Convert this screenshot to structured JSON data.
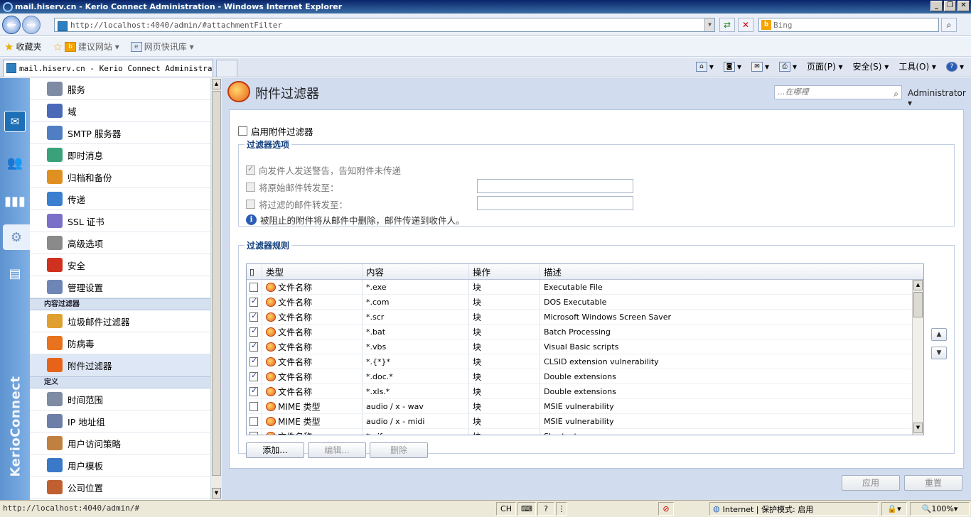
{
  "window": {
    "title": "mail.hiserv.cn - Kerio Connect Administration - Windows Internet Explorer",
    "url": "http://localhost:4040/admin/#attachmentFilter",
    "search_placeholder": "Bing",
    "tab_title": "mail.hiserv.cn - Kerio Connect Administra...",
    "buttons": {
      "minimize": "_",
      "restore": "❐",
      "close": "✕"
    }
  },
  "favorites": {
    "favorites_label": "收藏夹",
    "suggested_sites": "建议网站 ▾",
    "web_slice": "网页快讯库 ▾"
  },
  "commands": {
    "page": "页面(P) ▾",
    "safety": "安全(S) ▾",
    "tools": "工具(O) ▾"
  },
  "sidebar": {
    "brand": "KerioConnect",
    "items_top": [
      {
        "label": "服务",
        "icon": "services-icon",
        "color": "#7f8aa3"
      },
      {
        "label": "域",
        "icon": "domain-icon",
        "color": "#4a6ab8"
      },
      {
        "label": "SMTP 服务器",
        "icon": "smtp-server-icon",
        "color": "#4f7fc2"
      },
      {
        "label": "即时消息",
        "icon": "instant-message-icon",
        "color": "#3aa27a"
      },
      {
        "label": "归档和备份",
        "icon": "archive-backup-icon",
        "color": "#e09020"
      },
      {
        "label": "传递",
        "icon": "delivery-icon",
        "color": "#3a7fd0"
      },
      {
        "label": "SSL 证书",
        "icon": "ssl-certificate-icon",
        "color": "#7a70c8"
      },
      {
        "label": "高级选项",
        "icon": "advanced-options-icon",
        "color": "#8a8a8a"
      },
      {
        "label": "安全",
        "icon": "security-icon",
        "color": "#d0301e"
      },
      {
        "label": "管理设置",
        "icon": "admin-settings-icon",
        "color": "#6e86b6"
      }
    ],
    "section_content_filter": "内容过滤器",
    "items_filter": [
      {
        "label": "垃圾邮件过滤器",
        "icon": "spam-filter-icon",
        "color": "#e0a030"
      },
      {
        "label": "防病毒",
        "icon": "antivirus-icon",
        "color": "#e8721e"
      },
      {
        "label": "附件过滤器",
        "icon": "attachment-filter-icon",
        "color": "#e8631a"
      }
    ],
    "section_definitions": "定义",
    "items_defs": [
      {
        "label": "时间范围",
        "icon": "time-range-icon",
        "color": "#7f8aa3"
      },
      {
        "label": "IP 地址组",
        "icon": "ip-group-icon",
        "color": "#6d7fa6"
      },
      {
        "label": "用户访问策略",
        "icon": "user-access-policy-icon",
        "color": "#c08040"
      },
      {
        "label": "用户模板",
        "icon": "user-template-icon",
        "color": "#3a78c8"
      },
      {
        "label": "公司位置",
        "icon": "company-location-icon",
        "color": "#c06030"
      }
    ]
  },
  "main": {
    "title": "附件过滤器",
    "search_placeholder": "...在哪裡",
    "user": "Administrator ▾",
    "enable_label": "启用附件过滤器",
    "options_legend": "过滤器选项",
    "opt_warn": "向发件人发送警告，告知附件未传递",
    "opt_forward_original": "将原始邮件转发至：",
    "opt_forward_filtered": "将过滤的邮件转发至：",
    "info_text": "被阻止的附件将从邮件中删除，邮件传递到收件人。",
    "rules_legend": "过滤器规则",
    "columns": {
      "type": "类型",
      "content": "内容",
      "action": "操作",
      "description": "描述"
    },
    "rules": [
      {
        "checked": false,
        "type": "文件名称",
        "content": "*.exe",
        "action": "块",
        "description": "Executable File"
      },
      {
        "checked": true,
        "type": "文件名称",
        "content": "*.com",
        "action": "块",
        "description": "DOS Executable"
      },
      {
        "checked": true,
        "type": "文件名称",
        "content": "*.scr",
        "action": "块",
        "description": "Microsoft Windows Screen Saver"
      },
      {
        "checked": true,
        "type": "文件名称",
        "content": "*.bat",
        "action": "块",
        "description": "Batch Processing"
      },
      {
        "checked": true,
        "type": "文件名称",
        "content": "*.vbs",
        "action": "块",
        "description": "Visual Basic scripts"
      },
      {
        "checked": true,
        "type": "文件名称",
        "content": "*.{*}*",
        "action": "块",
        "description": "CLSID extension vulnerability"
      },
      {
        "checked": true,
        "type": "文件名称",
        "content": "*.doc.*",
        "action": "块",
        "description": "Double extensions"
      },
      {
        "checked": true,
        "type": "文件名称",
        "content": "*.xls.*",
        "action": "块",
        "description": "Double extensions"
      },
      {
        "checked": false,
        "type": "MIME 类型",
        "content": "audio / x - wav",
        "action": "块",
        "description": "MSIE vulnerability"
      },
      {
        "checked": false,
        "type": "MIME 类型",
        "content": "audio / x - midi",
        "action": "块",
        "description": "MSIE vulnerability"
      },
      {
        "checked": false,
        "type": "文件名称",
        "content": "*.pif",
        "action": "块",
        "description": "Shortcut"
      }
    ],
    "add": "添加...",
    "edit": "编辑...",
    "delete": "删除",
    "apply": "应用",
    "reset": "重置"
  },
  "status": {
    "url": "http://localhost:4040/admin/#",
    "ime": "CH",
    "zone": "Internet | 保护模式: 启用",
    "zoom": "100%"
  }
}
